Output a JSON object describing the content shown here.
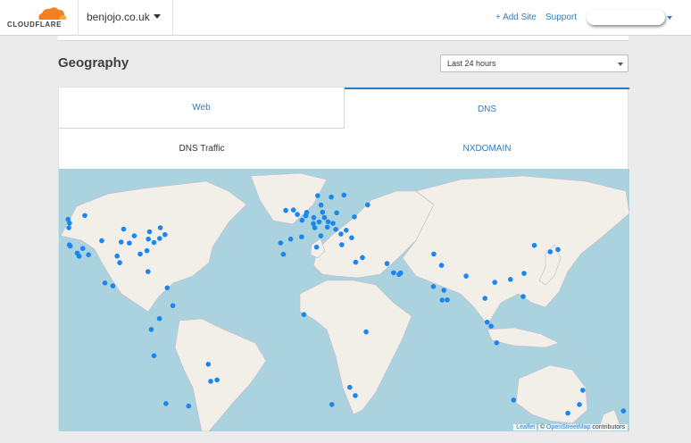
{
  "brand": {
    "name": "CLOUDFLARE",
    "accent": "#f38020",
    "accent_light": "#fbad41"
  },
  "header": {
    "domain": "benjojo.co.uk",
    "add_site_label": "+ Add Site",
    "support_label": "Support",
    "account_name": ""
  },
  "geography": {
    "title": "Geography",
    "range": {
      "selected": "Last 24 hours"
    },
    "tabs": [
      {
        "label": "Web",
        "active": false
      },
      {
        "label": "DNS",
        "active": true
      }
    ],
    "subtabs": [
      {
        "label": "DNS Traffic",
        "active": true
      },
      {
        "label": "NXDOMAIN",
        "active": false
      }
    ]
  },
  "map": {
    "water_color": "#aad3df",
    "land_color": "#f2efe9",
    "marker_color": "#1a86f0",
    "attribution": {
      "leaflet": "Leaflet",
      "separator": " | © ",
      "osm": "OpenStreetMap",
      "suffix": " contributors"
    },
    "markers": [
      {
        "lat": 47.6,
        "lon": -122.3
      },
      {
        "lat": 45.5,
        "lon": -122.7
      },
      {
        "lat": 37.8,
        "lon": -122.4
      },
      {
        "lat": 37.3,
        "lon": -121.9
      },
      {
        "lat": 34.1,
        "lon": -118.2
      },
      {
        "lat": 33.4,
        "lon": -112.1
      },
      {
        "lat": 32.7,
        "lon": -117.2
      },
      {
        "lat": 36.2,
        "lon": -115.2
      },
      {
        "lat": 39.7,
        "lon": -105.0
      },
      {
        "lat": 32.8,
        "lon": -96.8
      },
      {
        "lat": 29.8,
        "lon": -95.4
      },
      {
        "lat": 41.9,
        "lon": -87.6
      },
      {
        "lat": 44.9,
        "lon": -93.3
      },
      {
        "lat": 39.1,
        "lon": -94.6
      },
      {
        "lat": 38.6,
        "lon": -90.2
      },
      {
        "lat": 33.7,
        "lon": -84.4
      },
      {
        "lat": 25.8,
        "lon": -80.2
      },
      {
        "lat": 40.7,
        "lon": -74.0
      },
      {
        "lat": 38.9,
        "lon": -77.0
      },
      {
        "lat": 42.4,
        "lon": -71.1
      },
      {
        "lat": 43.7,
        "lon": -79.4
      },
      {
        "lat": 45.5,
        "lon": -73.6
      },
      {
        "lat": 35.2,
        "lon": -80.8
      },
      {
        "lat": 40.4,
        "lon": -80.0
      },
      {
        "lat": 49.3,
        "lon": -123.1
      },
      {
        "lat": 51.0,
        "lon": -114.1
      },
      {
        "lat": 19.4,
        "lon": -99.1
      },
      {
        "lat": 20.7,
        "lon": -103.3
      },
      {
        "lat": 18.5,
        "lon": -69.9
      },
      {
        "lat": 4.7,
        "lon": -74.1
      },
      {
        "lat": 10.5,
        "lon": -66.9
      },
      {
        "lat": -0.2,
        "lon": -78.5
      },
      {
        "lat": -12.0,
        "lon": -77.0
      },
      {
        "lat": -15.8,
        "lon": -47.9
      },
      {
        "lat": -23.5,
        "lon": -46.6
      },
      {
        "lat": -22.9,
        "lon": -43.2
      },
      {
        "lat": -34.6,
        "lon": -58.4
      },
      {
        "lat": -33.5,
        "lon": -70.6
      },
      {
        "lat": 51.5,
        "lon": -0.1
      },
      {
        "lat": 53.5,
        "lon": -2.2
      },
      {
        "lat": 53.3,
        "lon": -6.3
      },
      {
        "lat": 48.9,
        "lon": 2.4
      },
      {
        "lat": 52.4,
        "lon": 4.9
      },
      {
        "lat": 50.1,
        "lon": 8.7
      },
      {
        "lat": 52.5,
        "lon": 13.4
      },
      {
        "lat": 48.1,
        "lon": 11.6
      },
      {
        "lat": 50.9,
        "lon": 4.4
      },
      {
        "lat": 47.4,
        "lon": 8.5
      },
      {
        "lat": 45.5,
        "lon": 9.2
      },
      {
        "lat": 41.9,
        "lon": 12.5
      },
      {
        "lat": 40.4,
        "lon": -3.7
      },
      {
        "lat": 41.4,
        "lon": 2.2
      },
      {
        "lat": 38.7,
        "lon": -9.1
      },
      {
        "lat": 48.2,
        "lon": 16.4
      },
      {
        "lat": 50.1,
        "lon": 14.4
      },
      {
        "lat": 52.2,
        "lon": 21.0
      },
      {
        "lat": 59.3,
        "lon": 18.1
      },
      {
        "lat": 59.9,
        "lon": 10.8
      },
      {
        "lat": 55.7,
        "lon": 12.6
      },
      {
        "lat": 60.2,
        "lon": 24.9
      },
      {
        "lat": 47.5,
        "lon": 19.0
      },
      {
        "lat": 44.4,
        "lon": 26.1
      },
      {
        "lat": 42.7,
        "lon": 23.3
      },
      {
        "lat": 37.9,
        "lon": 23.7
      },
      {
        "lat": 41.0,
        "lon": 29.0
      },
      {
        "lat": 50.4,
        "lon": 30.5
      },
      {
        "lat": 55.8,
        "lon": 37.6
      },
      {
        "lat": 45.8,
        "lon": 16.0
      },
      {
        "lat": 44.8,
        "lon": 20.5
      },
      {
        "lat": 32.1,
        "lon": 34.8
      },
      {
        "lat": 25.2,
        "lon": 55.3
      },
      {
        "lat": 25.3,
        "lon": 51.5
      },
      {
        "lat": 24.5,
        "lon": 54.4
      },
      {
        "lat": 29.4,
        "lon": 48.0
      },
      {
        "lat": 33.7,
        "lon": 73.1
      },
      {
        "lat": 28.6,
        "lon": 77.2
      },
      {
        "lat": 19.1,
        "lon": 72.9
      },
      {
        "lat": 13.0,
        "lon": 77.6
      },
      {
        "lat": 13.1,
        "lon": 80.3
      },
      {
        "lat": 17.4,
        "lon": 78.5
      },
      {
        "lat": 23.8,
        "lon": 90.4
      },
      {
        "lat": 13.8,
        "lon": 100.5
      },
      {
        "lat": 21.0,
        "lon": 105.8
      },
      {
        "lat": 1.3,
        "lon": 103.8
      },
      {
        "lat": 3.1,
        "lon": 101.7
      },
      {
        "lat": -6.2,
        "lon": 106.8
      },
      {
        "lat": 14.6,
        "lon": 121.0
      },
      {
        "lat": 22.3,
        "lon": 114.2
      },
      {
        "lat": 25.0,
        "lon": 121.5
      },
      {
        "lat": 37.6,
        "lon": 127.0
      },
      {
        "lat": 35.7,
        "lon": 139.7
      },
      {
        "lat": 34.7,
        "lon": 135.5
      },
      {
        "lat": 30.0,
        "lon": 31.2
      },
      {
        "lat": 36.8,
        "lon": 10.2
      },
      {
        "lat": 33.6,
        "lon": -7.6
      },
      {
        "lat": 6.5,
        "lon": 3.4
      },
      {
        "lat": -1.3,
        "lon": 36.8
      },
      {
        "lat": -26.2,
        "lon": 28.0
      },
      {
        "lat": -33.9,
        "lon": 18.4
      },
      {
        "lat": -29.9,
        "lon": 31.0
      },
      {
        "lat": -33.9,
        "lon": 151.2
      },
      {
        "lat": -37.8,
        "lon": 145.0
      },
      {
        "lat": -27.5,
        "lon": 153.0
      },
      {
        "lat": -31.9,
        "lon": 115.9
      },
      {
        "lat": -36.8,
        "lon": 174.8
      }
    ]
  }
}
